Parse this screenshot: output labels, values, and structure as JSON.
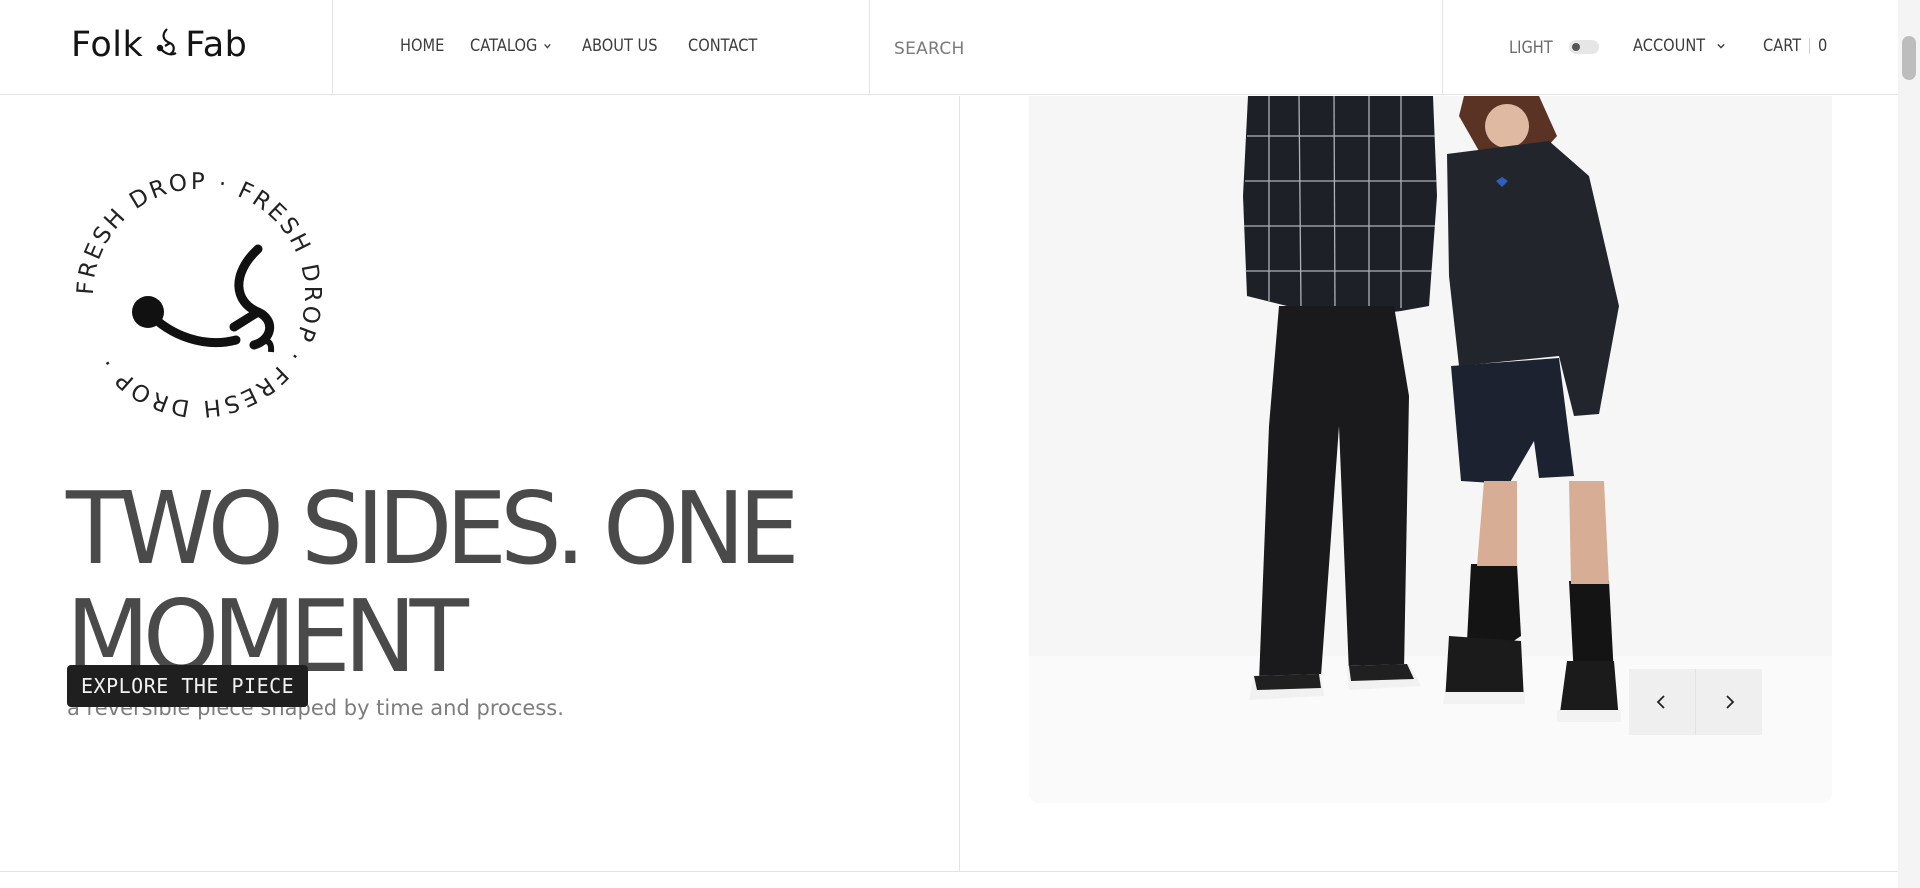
{
  "brand": {
    "name_left": "Folk",
    "name_right": "Fab"
  },
  "nav": {
    "items": [
      {
        "label": "HOME",
        "has_dropdown": false
      },
      {
        "label": "CATALOG",
        "has_dropdown": true
      },
      {
        "label": "ABOUT US",
        "has_dropdown": false
      },
      {
        "label": "CONTACT",
        "has_dropdown": false
      }
    ]
  },
  "search": {
    "placeholder": "SEARCH",
    "value": ""
  },
  "tools": {
    "theme_label": "LIGHT",
    "theme_toggle_on": false,
    "account_label": "ACCOUNT",
    "cart_label": "CART",
    "cart_count": "0"
  },
  "hero": {
    "badge_text": "FRESH DROP · FRESH DROP · FRESH DROP · ",
    "headline_line1": "TWO SIDES. ONE",
    "headline_line2": "MOMENT",
    "subline": "a reversible piece shaped by time and process.",
    "cta_label": "EXPLORE THE PIECE"
  },
  "slider": {
    "prev_icon": "chevron-left-icon",
    "next_icon": "chevron-right-icon"
  },
  "colors": {
    "accent": "#1f1f1f",
    "headline": "#4a4a4a",
    "border": "#e4e4e4"
  }
}
